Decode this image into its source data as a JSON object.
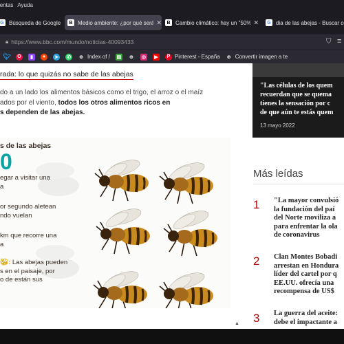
{
  "menubar": {
    "items": [
      "ientas",
      "Ayuda"
    ]
  },
  "tabs": [
    {
      "title": "Búsqueda de Google",
      "icon": "google-icon",
      "active": false
    },
    {
      "title": "Medio ambiente: ¿por qué será",
      "icon": "bbc-icon",
      "active": true
    },
    {
      "title": "Cambio climático: hay un \"50%",
      "icon": "bbc-icon",
      "active": false
    },
    {
      "title": "dia de las abejas - Buscar con",
      "icon": "google-icon",
      "active": false
    }
  ],
  "navbar": {
    "url": "https://www.bbc.com/mundo/noticias-40093433"
  },
  "bookmarks": [
    {
      "label": "",
      "icon": "twitter-icon"
    },
    {
      "label": "",
      "icon": "opera-icon"
    },
    {
      "label": "",
      "icon": "twitch-icon"
    },
    {
      "label": "",
      "icon": "reddit-icon"
    },
    {
      "label": "",
      "icon": "telegram-icon"
    },
    {
      "label": "",
      "icon": "whatsapp-icon"
    },
    {
      "label": "Index of /",
      "icon": "globe-icon"
    },
    {
      "label": "",
      "icon": "rarbg-icon"
    },
    {
      "label": "",
      "icon": "globe-icon"
    },
    {
      "label": "",
      "icon": "instagram-icon"
    },
    {
      "label": "",
      "icon": "youtube-icon"
    },
    {
      "label": "Pinterest - España",
      "icon": "pinterest-icon"
    },
    {
      "label": "Convertir imagen a te",
      "icon": "globe-icon"
    }
  ],
  "article": {
    "headline_link": "rada: lo que quizás no sabe de las abejas",
    "paragraph_line1": "do a un lado los alimentos básicos como el trigo, el arroz o el maíz",
    "paragraph_line2_plain": "ados por el viento, ",
    "paragraph_line2_bold": "todos los otros alimentos ricos en",
    "paragraph_line3_bold": "s dependen de las abejas."
  },
  "figure": {
    "title": "s de las abejas",
    "big_number": "0",
    "fact1": [
      "egar a visitar una",
      "a"
    ],
    "fact2": [
      "or segundo aletean",
      "ndo vuelan"
    ],
    "fact3": [
      "km que recorre una",
      "a"
    ],
    "fact4_emph": ":",
    "fact4": [
      " Las abejas pueden",
      "s en el paisaje, por",
      "o de están sus"
    ]
  },
  "sidebar": {
    "quote_lines": [
      "\"Las células de los quem",
      "recuerdan que se quema",
      "tienes la sensación por c",
      "de que aún te estás quem"
    ],
    "quote_date": "13 mayo 2022",
    "most_read_title": "Más leídas",
    "most_read": [
      {
        "rank": "1",
        "lines": [
          "\"La mayor convulsió",
          "la fundación del paí",
          "del Norte moviliza a",
          "para enfrentar la ola",
          "de coronavirus"
        ]
      },
      {
        "rank": "2",
        "lines": [
          "Clan Montes Bobadi",
          "arrestan en Hondura",
          "líder del cartel por q",
          "EE.UU. ofrecía una",
          "recompensa de US$"
        ]
      },
      {
        "rank": "3",
        "lines": [
          "La guerra del aceite:",
          "debe el impactante a"
        ]
      }
    ]
  },
  "colors": {
    "accent": "#b80000",
    "teal": "#0aa3a3",
    "tab_active": "#42414d",
    "chrome": "#1c1b22"
  }
}
